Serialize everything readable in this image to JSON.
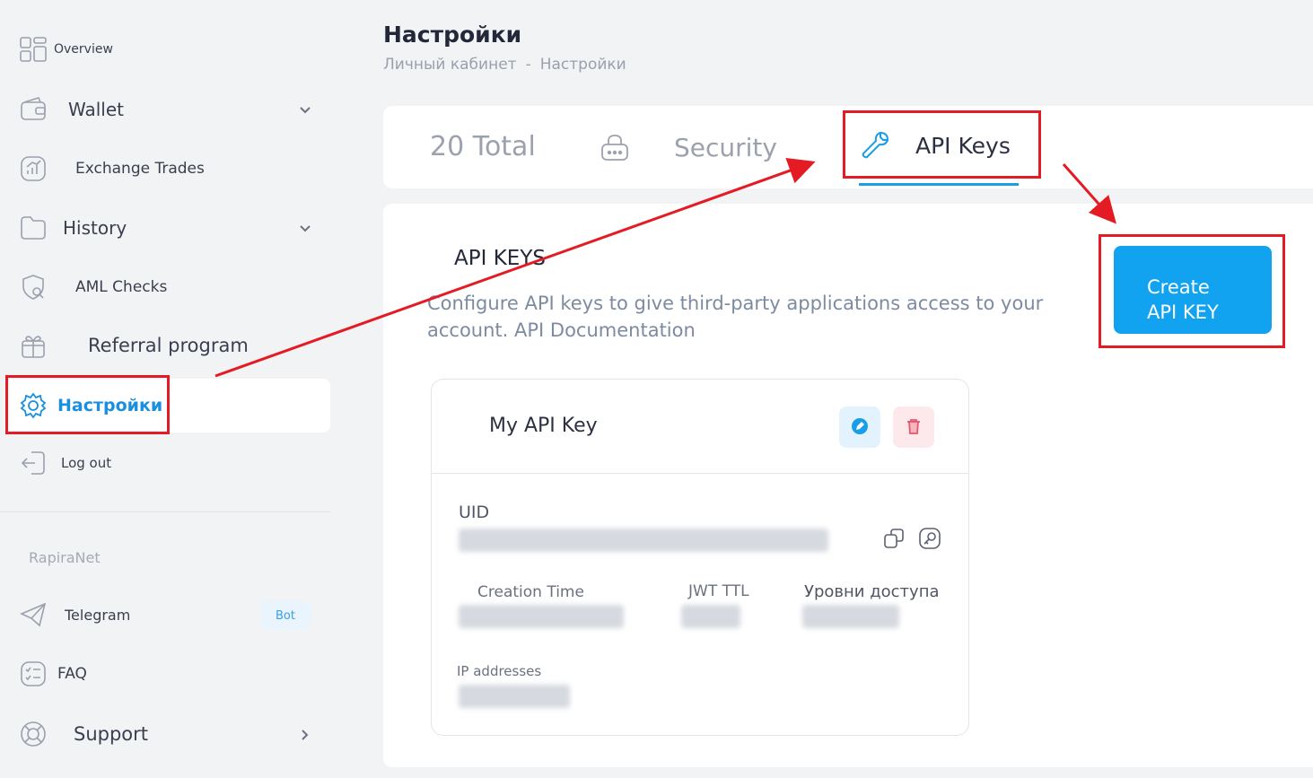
{
  "sidebar": {
    "items": [
      {
        "label": "Overview",
        "icon": "dashboard-icon"
      },
      {
        "label": "Wallet",
        "icon": "wallet-icon"
      },
      {
        "label": "Exchange Trades",
        "icon": "chart-icon"
      },
      {
        "label": "History",
        "icon": "folder-icon"
      },
      {
        "label": "AML Checks",
        "icon": "search-shield-icon"
      },
      {
        "label": "Referral program",
        "icon": "gift-icon"
      },
      {
        "label": "Настройки",
        "icon": "gear-icon"
      },
      {
        "label": "Log out",
        "icon": "logout-icon"
      }
    ],
    "section_label": "RapiraNet",
    "network_items": [
      {
        "label": "Telegram",
        "icon": "telegram-icon",
        "badge": "Bot"
      },
      {
        "label": "FAQ",
        "icon": "checklist-icon"
      },
      {
        "label": "Support",
        "icon": "lifebuoy-icon"
      }
    ]
  },
  "header": {
    "title": "Настройки",
    "breadcrumb": [
      "Личный кабинет",
      "-",
      "Настройки"
    ]
  },
  "tabs": {
    "total": "20 Total",
    "security": "Security",
    "api": "API Keys"
  },
  "api_section": {
    "title": "API KEYS",
    "description": "Configure API keys to give third-party applications access to your account. API Documentation",
    "create_button": [
      "Create",
      "API KEY"
    ]
  },
  "key_card": {
    "name": "My API Key",
    "uid_label": "UID",
    "creation_time_label": "Creation Time",
    "jwt_ttl_label": "JWT TTL",
    "access_levels_label": "Уровни доступа",
    "ip_label": "IP addresses"
  },
  "colors": {
    "accent": "#12a3f0",
    "active_text": "#1a8fe0",
    "annotation": "#e41b23"
  }
}
